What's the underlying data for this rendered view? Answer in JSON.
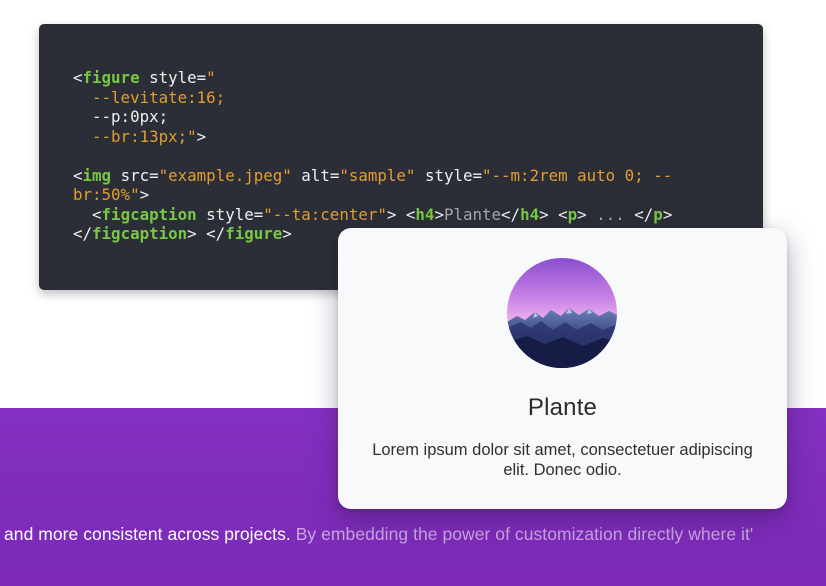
{
  "code": {
    "lines": [
      [
        {
          "t": "<",
          "c": "white"
        },
        {
          "t": "figure",
          "c": "tag"
        },
        {
          "t": " style=",
          "c": "white"
        },
        {
          "t": "\"",
          "c": "str"
        }
      ],
      [
        {
          "t": "  --levitate:16;",
          "c": "str"
        }
      ],
      [
        {
          "t": "  --p:0px;",
          "c": "white"
        }
      ],
      [
        {
          "t": "  --br:13px;\"",
          "c": "str"
        },
        {
          "t": ">",
          "c": "white"
        }
      ],
      [],
      [
        {
          "t": "<",
          "c": "white"
        },
        {
          "t": "img",
          "c": "tag"
        },
        {
          "t": " src=",
          "c": "white"
        },
        {
          "t": "\"example.jpeg\"",
          "c": "str"
        },
        {
          "t": " alt=",
          "c": "white"
        },
        {
          "t": "\"sample\"",
          "c": "str"
        },
        {
          "t": " style=",
          "c": "white"
        },
        {
          "t": "\"--m:2rem auto 0; --",
          "c": "str"
        }
      ],
      [
        {
          "t": "br:50%\"",
          "c": "str"
        },
        {
          "t": ">",
          "c": "white"
        }
      ],
      [
        {
          "t": "  <",
          "c": "white"
        },
        {
          "t": "figcaption",
          "c": "tag"
        },
        {
          "t": " style=",
          "c": "white"
        },
        {
          "t": "\"--ta:center\"",
          "c": "str"
        },
        {
          "t": "> <",
          "c": "white"
        },
        {
          "t": "h4",
          "c": "tag"
        },
        {
          "t": ">",
          "c": "white"
        },
        {
          "t": "Plante",
          "c": "dim"
        },
        {
          "t": "</",
          "c": "white"
        },
        {
          "t": "h4",
          "c": "tag"
        },
        {
          "t": "> <",
          "c": "white"
        },
        {
          "t": "p",
          "c": "tag"
        },
        {
          "t": "> ",
          "c": "white"
        },
        {
          "t": "...",
          "c": "dim"
        },
        {
          "t": " </",
          "c": "white"
        },
        {
          "t": "p",
          "c": "tag"
        },
        {
          "t": ">",
          "c": "white"
        }
      ],
      [
        {
          "t": "</",
          "c": "white"
        },
        {
          "t": "figcaption",
          "c": "tag"
        },
        {
          "t": "> </",
          "c": "white"
        },
        {
          "t": "figure",
          "c": "tag"
        },
        {
          "t": ">",
          "c": "white"
        }
      ]
    ]
  },
  "card": {
    "title": "Plante",
    "text": "Lorem ipsum dolor sit amet, consectetuer adipiscing elit. Donec odio.",
    "image_alt": "sample"
  },
  "band": {
    "text_main": "and more consistent across projects. ",
    "text_fade": "By embedding the power of customization directly where it'"
  },
  "colors": {
    "code_bg": "#2b2e36",
    "tag": "#79c844",
    "string": "#e39d31",
    "band": "#7f2bbf",
    "card_bg": "#f8f9fb"
  }
}
